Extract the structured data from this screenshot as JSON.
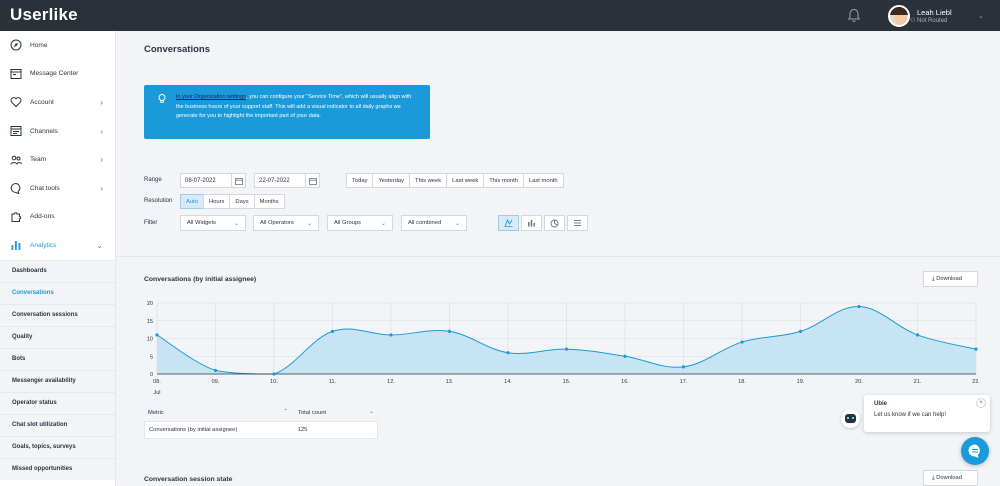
{
  "app": {
    "logo": "Userlike"
  },
  "user": {
    "name": "Leah Liebl",
    "status": "Not Routed"
  },
  "sidebar": {
    "items": [
      {
        "label": "Home",
        "icon": "compass-icon",
        "chevron": false
      },
      {
        "label": "Message Center",
        "icon": "inbox-icon",
        "chevron": false
      },
      {
        "label": "Account",
        "icon": "heart-icon",
        "chevron": true
      },
      {
        "label": "Channels",
        "icon": "channels-icon",
        "chevron": true
      },
      {
        "label": "Team",
        "icon": "team-icon",
        "chevron": true
      },
      {
        "label": "Chat tools",
        "icon": "chat-icon",
        "chevron": true
      },
      {
        "label": "Add-ons",
        "icon": "puzzle-icon",
        "chevron": false
      },
      {
        "label": "Analytics",
        "icon": "analytics-icon",
        "chevron": true
      }
    ],
    "analytics_sub": [
      "Dashboards",
      "Conversations",
      "Conversation sessions",
      "Quality",
      "Bots",
      "Messenger availability",
      "Operator status",
      "Chat slot utilization",
      "Goals, topics, surveys",
      "Missed opportunities"
    ],
    "active_sub": "Conversations"
  },
  "page": {
    "title": "Conversations",
    "info_link": "In your Organization settings",
    "info_text": ", you can configure your \"Service Time\", which will usually align with the business hours of your support staff. This will add a visual indicator to all daily graphs we generate for you to highlight the important part of your data."
  },
  "filters": {
    "range_label": "Range",
    "date_from": "08-07-2022",
    "date_to": "22-07-2022",
    "presets": [
      "Today",
      "Yesterday",
      "This week",
      "Last week",
      "This month",
      "Last month"
    ],
    "resolution_label": "Resolution",
    "resolutions": [
      "Auto",
      "Hours",
      "Days",
      "Months"
    ],
    "resolution_selected": "Auto",
    "filter_label": "Filter",
    "dropdowns": [
      "All Widgets",
      "All Operators",
      "All Groups",
      "All combined"
    ],
    "views": [
      "area-chart-icon",
      "bar-chart-icon",
      "pie-chart-icon",
      "list-icon"
    ]
  },
  "section1": {
    "title": "Conversations (by initial assignee)",
    "download": "Download",
    "table": {
      "headers": [
        "Metric",
        "Total count"
      ],
      "rows": [
        [
          "Conversations (by initial assignee)",
          "125"
        ]
      ]
    }
  },
  "section2": {
    "title": "Conversation session state",
    "download": "Download"
  },
  "chat": {
    "bot_name": "Ubie",
    "message": "Let us know if we can help!"
  },
  "colors": {
    "accent": "#1a9ad8",
    "topbar": "#2b3139",
    "area_fill": "#bfe1f3"
  },
  "chart_data": {
    "type": "area",
    "x": [
      "08.",
      "09.",
      "10.",
      "11.",
      "12.",
      "13.",
      "14.",
      "15.",
      "16.",
      "17.",
      "18.",
      "19.",
      "20.",
      "21.",
      "22."
    ],
    "x_sublabel": "Jul",
    "values": [
      11,
      1,
      0,
      12,
      11,
      12,
      6,
      7,
      5,
      2,
      9,
      12,
      19,
      11,
      7
    ],
    "ylim": [
      0,
      20
    ],
    "yticks": [
      0,
      5,
      10,
      15,
      20
    ],
    "grid": true
  }
}
